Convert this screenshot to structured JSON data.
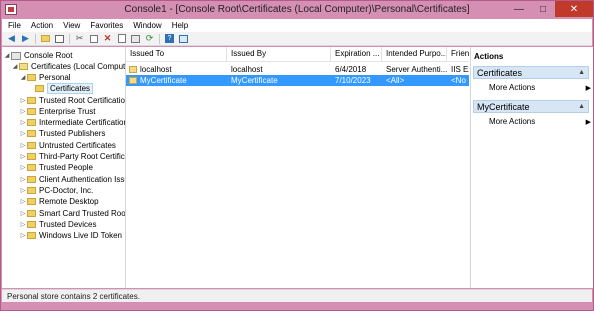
{
  "window": {
    "title": "Console1 - [Console Root\\Certificates (Local Computer)\\Personal\\Certificates]",
    "minimize": "—",
    "maximize": "□",
    "close": "✕"
  },
  "menu": {
    "items": [
      "File",
      "Action",
      "View",
      "Favorites",
      "Window",
      "Help"
    ]
  },
  "toolbar": {
    "icons": [
      "back-arrow",
      "forward-arrow",
      "up-folder",
      "show-hide-tree",
      "cut",
      "copy",
      "delete",
      "properties",
      "export",
      "refresh",
      "help",
      "show-hide-action-pane"
    ]
  },
  "tree": {
    "items": [
      {
        "label": "Console Root",
        "level": 0,
        "expanded": true,
        "selected": false
      },
      {
        "label": "Certificates (Local Compute",
        "level": 1,
        "expanded": true,
        "selected": false
      },
      {
        "label": "Personal",
        "level": 2,
        "expanded": true,
        "selected": false
      },
      {
        "label": "Certificates",
        "level": 3,
        "expanded": false,
        "selected": true
      },
      {
        "label": "Trusted Root Certification",
        "level": 2,
        "expanded": false,
        "selected": false
      },
      {
        "label": "Enterprise Trust",
        "level": 2,
        "expanded": false,
        "selected": false
      },
      {
        "label": "Intermediate Certification",
        "level": 2,
        "expanded": false,
        "selected": false
      },
      {
        "label": "Trusted Publishers",
        "level": 2,
        "expanded": false,
        "selected": false
      },
      {
        "label": "Untrusted Certificates",
        "level": 2,
        "expanded": false,
        "selected": false
      },
      {
        "label": "Third-Party Root Certificat",
        "level": 2,
        "expanded": false,
        "selected": false
      },
      {
        "label": "Trusted People",
        "level": 2,
        "expanded": false,
        "selected": false
      },
      {
        "label": "Client Authentication Issu",
        "level": 2,
        "expanded": false,
        "selected": false
      },
      {
        "label": "PC-Doctor, Inc.",
        "level": 2,
        "expanded": false,
        "selected": false
      },
      {
        "label": "Remote Desktop",
        "level": 2,
        "expanded": false,
        "selected": false
      },
      {
        "label": "Smart Card Trusted Roots",
        "level": 2,
        "expanded": false,
        "selected": false
      },
      {
        "label": "Trusted Devices",
        "level": 2,
        "expanded": false,
        "selected": false
      },
      {
        "label": "Windows Live ID Token Is",
        "level": 2,
        "expanded": false,
        "selected": false
      }
    ]
  },
  "list": {
    "columns": [
      "Issued To",
      "Issued By",
      "Expiration ...",
      "Intended Purpo...",
      "Frien"
    ],
    "rows": [
      {
        "issued_to": "localhost",
        "issued_by": "localhost",
        "expiration": "6/4/2018",
        "purpose": "Server Authenti...",
        "friendly": "IIS Ex",
        "selected": false
      },
      {
        "issued_to": "MyCertificate",
        "issued_by": "MyCertificate",
        "expiration": "7/10/2023",
        "purpose": "<All>",
        "friendly": "<No",
        "selected": true
      }
    ]
  },
  "actions": {
    "title": "Actions",
    "sections": [
      {
        "header": "Certificates",
        "items": [
          "More Actions"
        ]
      },
      {
        "header": "MyCertificate",
        "items": [
          "More Actions"
        ]
      }
    ]
  },
  "status": {
    "text": "Personal store contains 2 certificates."
  },
  "colors": {
    "title_bar": "#d58fb3",
    "selection": "#3399ff",
    "action_header": "#d6e6f5",
    "close_button": "#c0392b"
  }
}
